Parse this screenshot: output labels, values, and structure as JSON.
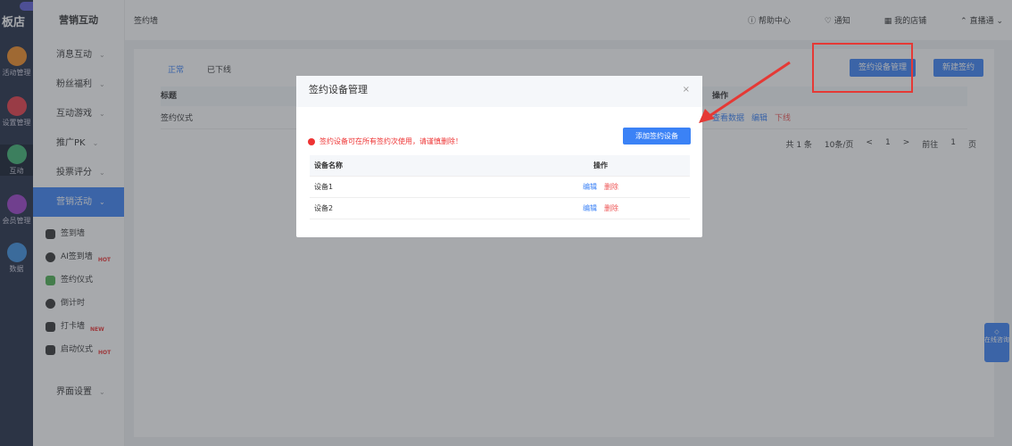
{
  "rail": {
    "logo": "板店",
    "items": [
      "活动管理",
      "设置管理",
      "互动",
      "会员管理",
      "数据"
    ]
  },
  "sidebar": {
    "title": "营销互动",
    "menus": [
      "消息互动",
      "粉丝福利",
      "互动游戏",
      "推广PK",
      "投票评分",
      "营销活动"
    ],
    "subs": [
      {
        "label": "签到墙",
        "tag": ""
      },
      {
        "label": "AI签到墙",
        "tag": "HOT"
      },
      {
        "label": "签约仪式",
        "tag": ""
      },
      {
        "label": "倒计时",
        "tag": ""
      },
      {
        "label": "打卡墙",
        "tag": "NEW"
      },
      {
        "label": "启动仪式",
        "tag": "HOT"
      }
    ],
    "bottom": "界面设置"
  },
  "header": {
    "breadcrumb": "签约墙",
    "help": "帮助中心",
    "notice": "通知",
    "shop": "我的店铺",
    "user": "直播通"
  },
  "main": {
    "tabs": [
      "正常",
      "已下线"
    ],
    "manage_btn": "签约设备管理",
    "new_btn": "新建签约",
    "columns": [
      "标题",
      "操作"
    ],
    "row": {
      "title": "签约仪式",
      "actions": [
        "查看数据",
        "编辑",
        "下线"
      ]
    },
    "pager": {
      "total": "共 1 条",
      "size": "10条/页",
      "prev": "<",
      "page": "1",
      "next": ">",
      "goto": "前往",
      "goto_val": "1",
      "unit": "页"
    }
  },
  "float": {
    "label": "在线咨询"
  },
  "modal": {
    "title": "签约设备管理",
    "close": "×",
    "warning": "签约设备可在所有签约次使用，请谨慎删除！",
    "add_btn": "添加签约设备",
    "columns": [
      "设备名称",
      "操作"
    ],
    "rows": [
      {
        "name": "设备1",
        "edit": "编辑",
        "del": "删除"
      },
      {
        "name": "设备2",
        "edit": "编辑",
        "del": "删除"
      }
    ]
  }
}
